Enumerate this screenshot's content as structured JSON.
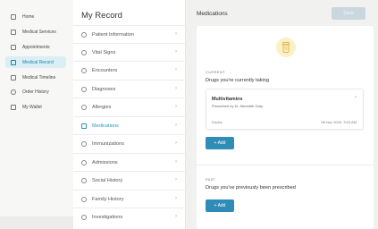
{
  "nav": {
    "items": [
      {
        "label": "Home",
        "icon": "home-icon",
        "active": false
      },
      {
        "label": "Medical Services",
        "icon": "services-icon",
        "active": false
      },
      {
        "label": "Appointments",
        "icon": "calendar-icon",
        "active": false
      },
      {
        "label": "Medical Record",
        "icon": "record-icon",
        "active": true
      },
      {
        "label": "Medical Timeline",
        "icon": "timeline-icon",
        "active": false
      },
      {
        "label": "Order History",
        "icon": "history-icon",
        "active": false
      },
      {
        "label": "My Wallet",
        "icon": "wallet-icon",
        "active": false
      }
    ]
  },
  "record": {
    "title": "My Record",
    "items": [
      {
        "label": "Patient Information",
        "icon": "user-icon"
      },
      {
        "label": "Vital Signs",
        "icon": "vitals-icon"
      },
      {
        "label": "Encounters",
        "icon": "people-icon"
      },
      {
        "label": "Diagnoses",
        "icon": "diagnosis-icon"
      },
      {
        "label": "Allergies",
        "icon": "allergy-icon"
      },
      {
        "label": "Medications",
        "icon": "pill-icon",
        "active": true
      },
      {
        "label": "Immunizations",
        "icon": "syringe-icon"
      },
      {
        "label": "Admissions",
        "icon": "bed-icon"
      },
      {
        "label": "Social History",
        "icon": "social-icon"
      },
      {
        "label": "Family History",
        "icon": "family-icon"
      },
      {
        "label": "Investigations",
        "icon": "search-icon"
      }
    ]
  },
  "main": {
    "title": "Medications",
    "save_label": "Save",
    "current": {
      "label": "CURRENT",
      "desc": "Drugs you're currently taking",
      "med": {
        "name": "Multivitamins",
        "prescribed": "Prescribed by Dr. Meredith Gray",
        "status": "Doctor",
        "date": "06 Nov 2020, 3:03 AM"
      },
      "add_label": "+ Add"
    },
    "past": {
      "label": "PAST",
      "desc": "Drugs you've previously been prescribed",
      "add_label": "+ Add"
    }
  },
  "colors": {
    "accent": "#2e8cb6",
    "active_bg": "#d9eef5",
    "pill_bg": "#fcf0c6"
  }
}
